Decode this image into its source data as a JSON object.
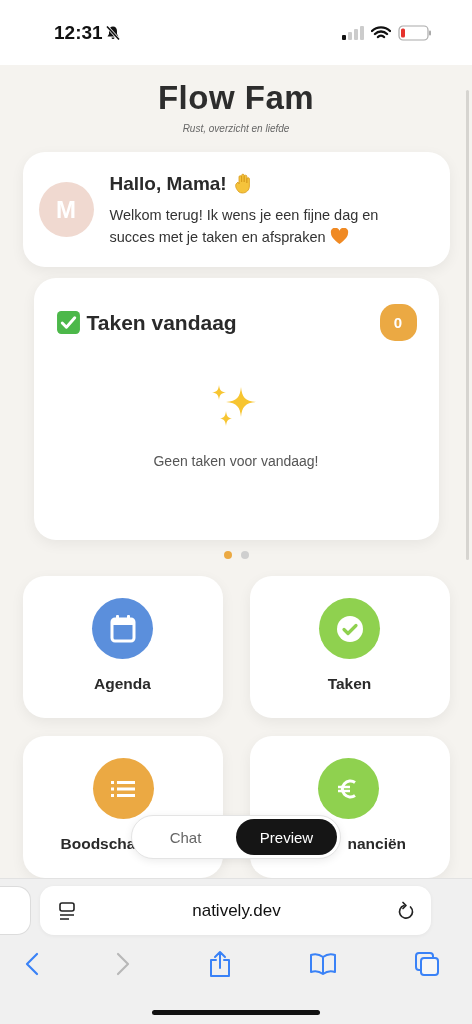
{
  "status_bar": {
    "time": "12:31",
    "silent": true
  },
  "app": {
    "title": "Flow Fam",
    "subtitle": "Rust, overzicht en liefde"
  },
  "greeting": {
    "avatar": "M",
    "title": "Hallo, Mama!",
    "message": "Welkom terug! Ik wens je een fijne dag en succes met je taken en afspraken"
  },
  "tasks_card": {
    "title": "Taken vandaag",
    "count": "0",
    "empty_text": "Geen taken voor vandaag!"
  },
  "pager": [
    {
      "selected": true
    },
    {
      "selected": false
    }
  ],
  "tiles": [
    {
      "label": "Agenda",
      "kind": "calendar",
      "color": "#5b8fdc"
    },
    {
      "label": "Taken",
      "kind": "check",
      "color": "#8fd14f"
    },
    {
      "label": "Boodscha",
      "kind": "list",
      "color": "#eba943"
    },
    {
      "label": "nanciën",
      "kind": "euro",
      "color": "#8fd14f"
    }
  ],
  "mode_toggle": [
    {
      "label": "Chat",
      "selected": false
    },
    {
      "label": "Preview",
      "selected": true
    }
  ],
  "browser": {
    "url": "natively.dev"
  }
}
